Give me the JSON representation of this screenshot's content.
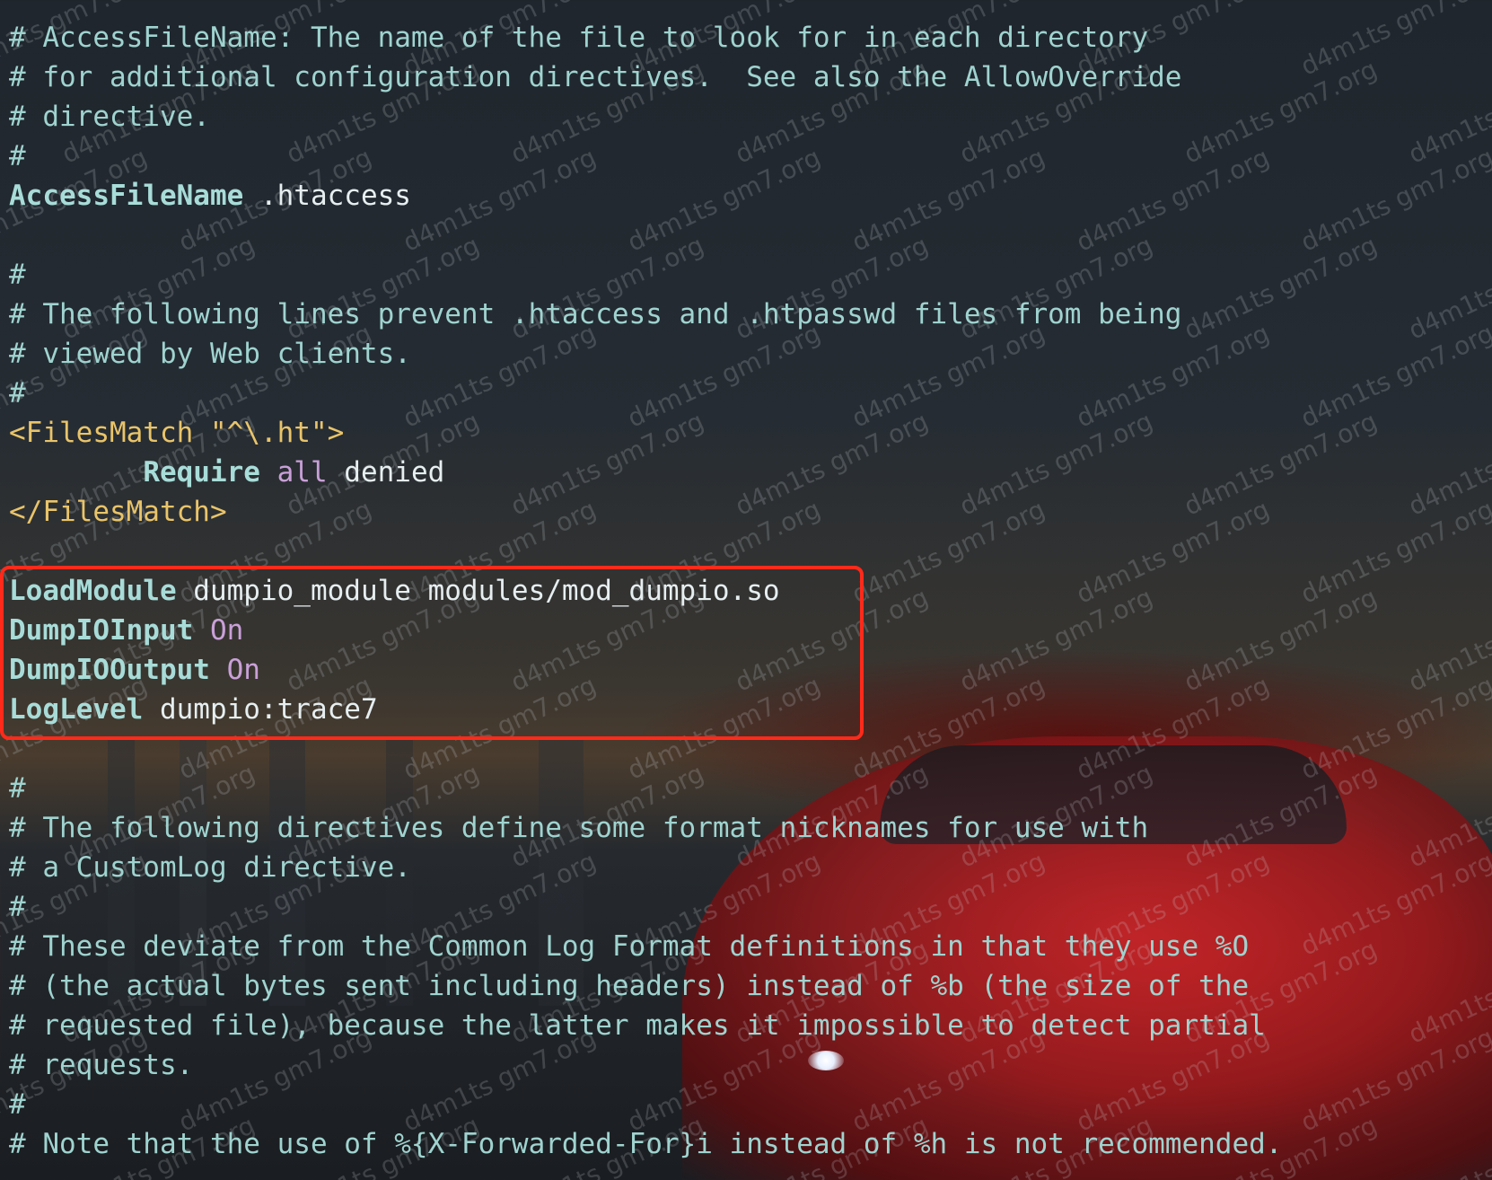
{
  "editor": {
    "lines": [
      {
        "type": "comment",
        "text": "# AccessFileName: The name of the file to look for in each directory"
      },
      {
        "type": "comment",
        "text": "# for additional configuration directives.  See also the AllowOverride"
      },
      {
        "type": "comment",
        "text": "# directive."
      },
      {
        "type": "comment",
        "text": "#"
      },
      {
        "type": "directive",
        "name": "AccessFileName",
        "value": " .htaccess"
      },
      {
        "type": "blank",
        "text": ""
      },
      {
        "type": "comment",
        "text": "#"
      },
      {
        "type": "comment",
        "text": "# The following lines prevent .htaccess and .htpasswd files from being"
      },
      {
        "type": "comment",
        "text": "# viewed by Web clients."
      },
      {
        "type": "comment",
        "text": "#"
      },
      {
        "type": "tag-open",
        "tag": "<FilesMatch",
        "arg": " \"^\\.ht\"",
        "close": ">"
      },
      {
        "type": "require",
        "indent": "        ",
        "name": "Require",
        "kw": " all",
        "value": " denied"
      },
      {
        "type": "tag-close",
        "tag": "</FilesMatch>"
      },
      {
        "type": "blank",
        "text": ""
      },
      {
        "type": "directive",
        "name": "LoadModule",
        "value": " dumpio_module modules/mod_dumpio.so"
      },
      {
        "type": "directive-kw",
        "name": "DumpIOInput",
        "kw": " On"
      },
      {
        "type": "directive-kw",
        "name": "DumpIOOutput",
        "kw": " On"
      },
      {
        "type": "directive",
        "name": "LogLevel",
        "value": " dumpio:trace7"
      },
      {
        "type": "blank",
        "text": ""
      },
      {
        "type": "comment",
        "text": "#"
      },
      {
        "type": "comment",
        "text": "# The following directives define some format nicknames for use with"
      },
      {
        "type": "comment",
        "text": "# a CustomLog directive."
      },
      {
        "type": "comment",
        "text": "#"
      },
      {
        "type": "comment",
        "text": "# These deviate from the Common Log Format definitions in that they use %O"
      },
      {
        "type": "comment",
        "text": "# (the actual bytes sent including headers) instead of %b (the size of the"
      },
      {
        "type": "comment",
        "text": "# requested file), because the latter makes it impossible to detect partial"
      },
      {
        "type": "comment",
        "text": "# requests."
      },
      {
        "type": "comment",
        "text": "#"
      },
      {
        "type": "comment",
        "text": "# Note that the use of %{X-Forwarded-For}i instead of %h is not recommended."
      }
    ],
    "highlight_color": "#ff2a1a"
  },
  "watermark": {
    "text": "d4m1ts gm7.org"
  }
}
